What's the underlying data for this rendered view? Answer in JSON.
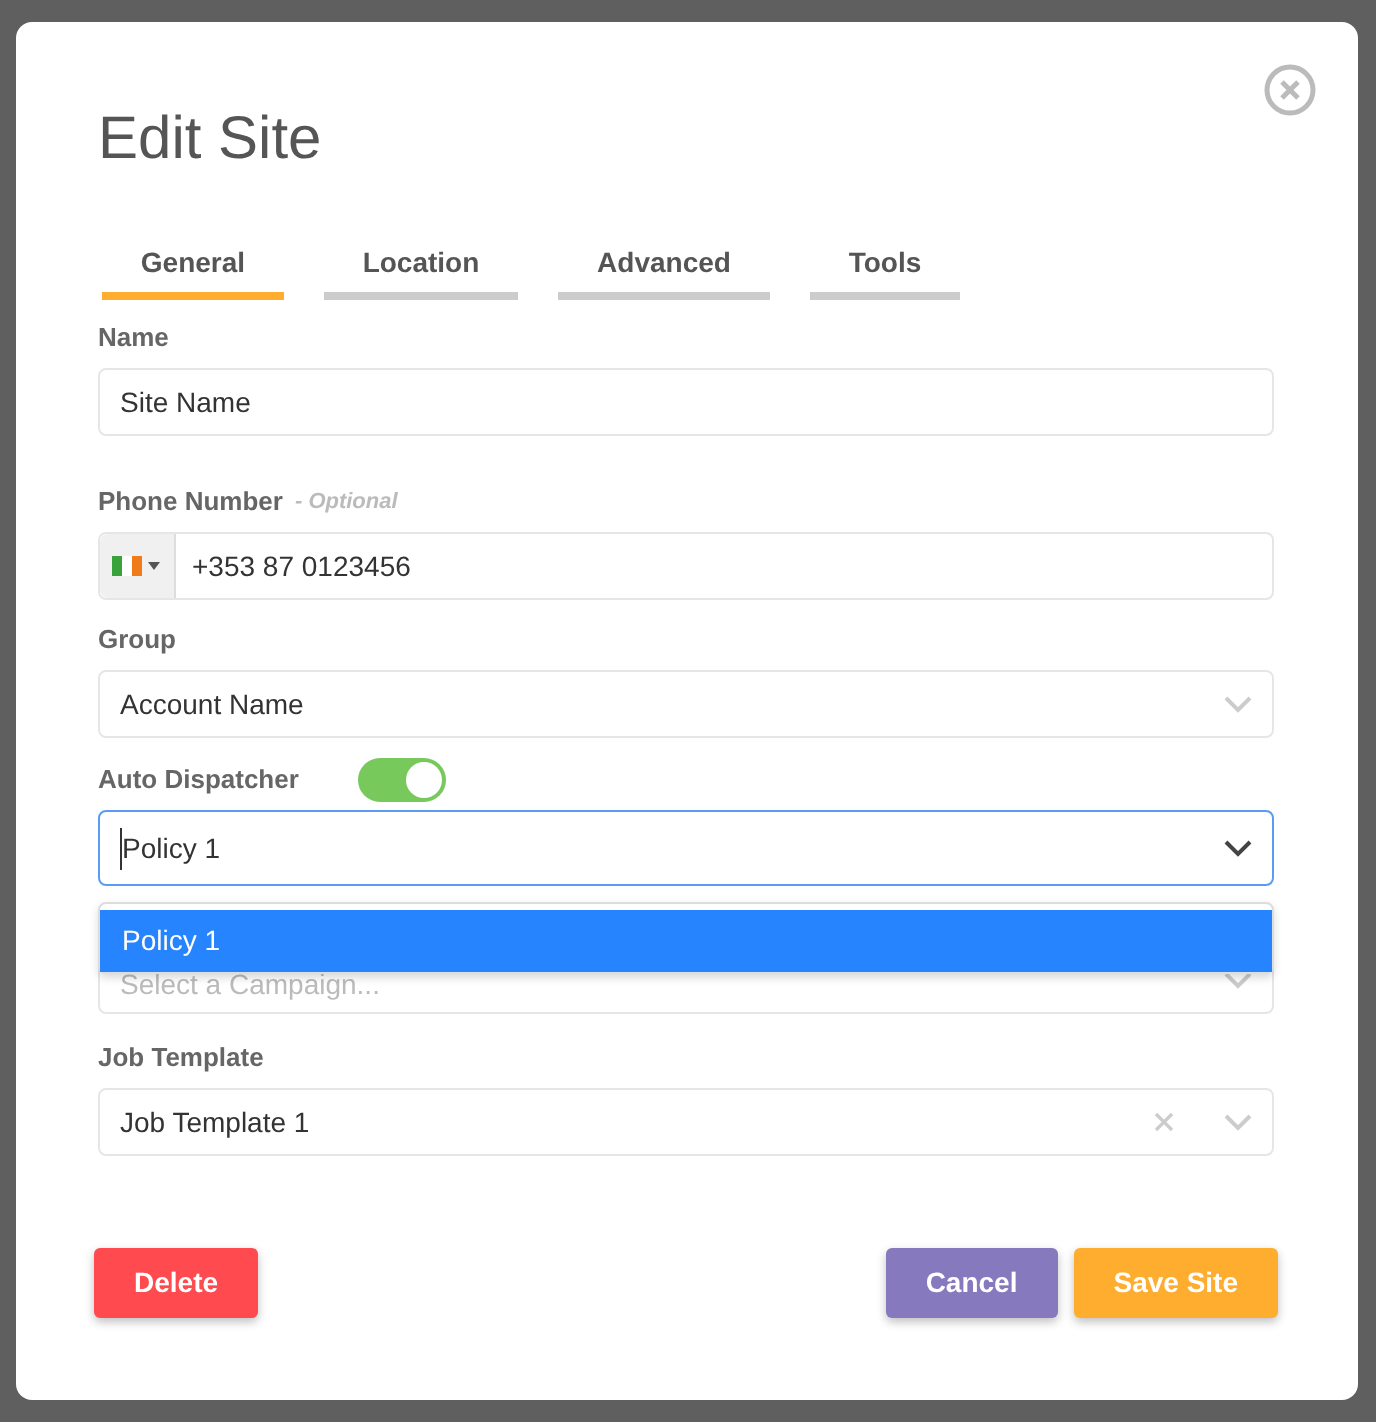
{
  "title": "Edit Site",
  "tabs": [
    {
      "label": "General",
      "selected": true
    },
    {
      "label": "Location",
      "selected": false
    },
    {
      "label": "Advanced",
      "selected": false
    },
    {
      "label": "Tools",
      "selected": false
    }
  ],
  "fields": [
    {
      "kind": "text",
      "label": "Name",
      "value": "Site Name"
    },
    {
      "kind": "phone",
      "label": "Phone Number",
      "hint": "- Optional",
      "value": "+353 87 0123456"
    },
    {
      "kind": "select",
      "label": "Group",
      "value": "Account Name"
    },
    {
      "kind": "toggle_select",
      "label": "Auto Dispatcher",
      "on": true,
      "value": "Policy 1",
      "options": [
        {
          "label": "Policy 1",
          "selected": true
        }
      ]
    },
    {
      "kind": "select",
      "placeholder": "Select a Campaign..."
    },
    {
      "kind": "select",
      "label": "Job Template",
      "value": "Job Template 1",
      "clearable": true
    }
  ],
  "left_buttons": [
    {
      "label": "Delete",
      "color": "#ff4b4f"
    }
  ],
  "right_buttons": [
    {
      "label": "Cancel",
      "color": "#8779bd"
    },
    {
      "label": "Save Site",
      "color": "#ffad2f"
    }
  ]
}
